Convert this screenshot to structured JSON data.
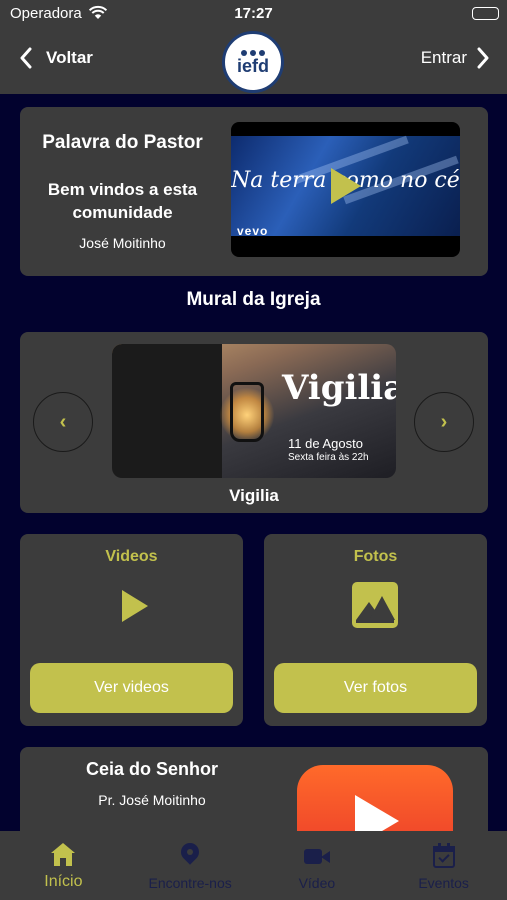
{
  "status_bar": {
    "carrier": "Operadora",
    "time": "17:27"
  },
  "nav": {
    "back_label": "Voltar",
    "logo_text": "iefd",
    "login_label": "Entrar"
  },
  "pastor_card": {
    "title": "Palavra do Pastor",
    "welcome": "Bem vindos a esta comunidade",
    "name": "José Moitinho",
    "video_overlay": "Na terra como no céu",
    "video_brand": "vevo"
  },
  "mural": {
    "section_title": "Mural da Igreja",
    "slide": {
      "title": "Vigilia",
      "date": "11 de Agosto",
      "time": "Sexta feira às 22h"
    },
    "caption": "Vigilia",
    "prev_icon": "‹",
    "next_icon": "›"
  },
  "videos_card": {
    "label": "Videos",
    "button": "Ver videos"
  },
  "fotos_card": {
    "label": "Fotos",
    "button": "Ver fotos"
  },
  "ceia_card": {
    "title": "Ceia do Senhor",
    "subtitle": "Pr. José Moitinho"
  },
  "tabs": [
    {
      "label": "Início",
      "icon": "home-icon",
      "active": true
    },
    {
      "label": "Encontre-nos",
      "icon": "location-pin-icon",
      "active": false
    },
    {
      "label": "Vídeo",
      "icon": "video-camera-icon",
      "active": false
    },
    {
      "label": "Eventos",
      "icon": "calendar-check-icon",
      "active": false
    }
  ],
  "colors": {
    "accent": "#c2c14d",
    "background": "#02022e",
    "card": "#3c3c3c",
    "inactive_tab": "#1a1f4a"
  }
}
